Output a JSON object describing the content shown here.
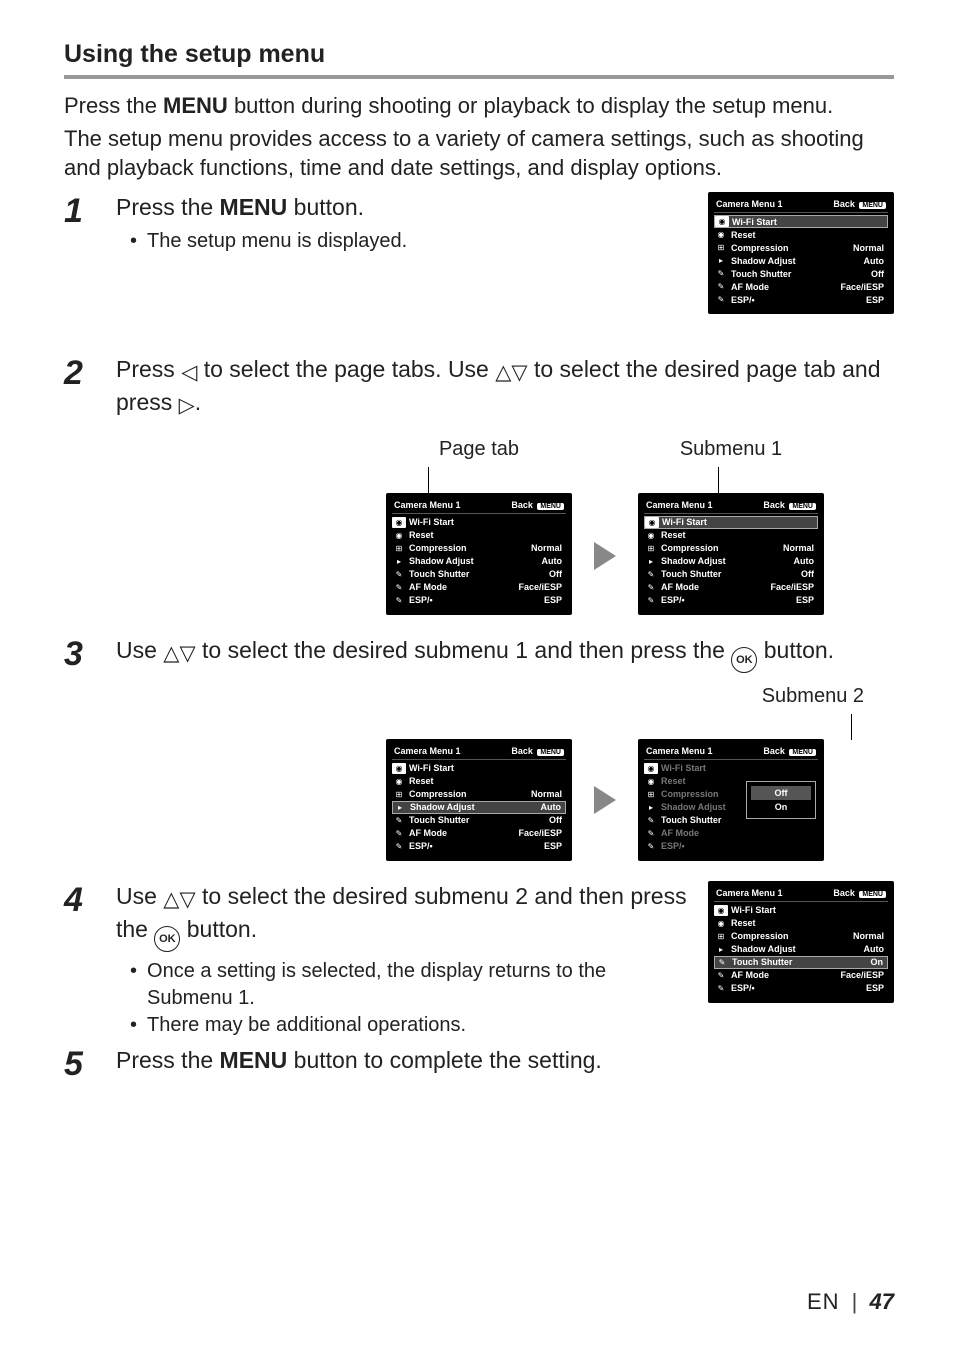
{
  "title": "Using the setup menu",
  "intro1a": "Press the ",
  "intro1b": "MENU",
  "intro1c": " button during shooting or playback to display the setup menu.",
  "intro2": "The setup menu provides access to a variety of camera settings, such as shooting and playback functions, time and date settings, and display options.",
  "ok": "OK",
  "steps": {
    "s1": {
      "num": "1",
      "a": "Press the ",
      "b": "MENU",
      "c": " button.",
      "bullet": "The setup menu is displayed."
    },
    "s2": {
      "num": "2",
      "text_parts": [
        "Press ",
        " to select the page tabs. Use ",
        " to select the desired page tab and press ",
        "."
      ]
    },
    "s3": {
      "num": "3",
      "text_parts": [
        "Use ",
        " to select the desired submenu 1 and then press the ",
        " button."
      ]
    },
    "s4": {
      "num": "4",
      "text_parts": [
        "Use ",
        " to select the desired submenu 2 and then press the ",
        " button."
      ],
      "b1": "Once a setting is selected, the display returns to the Submenu 1.",
      "b2": "There may be additional operations."
    },
    "s5": {
      "num": "5",
      "a": "Press the ",
      "b": "MENU",
      "c": " button to complete the setting."
    }
  },
  "labels": {
    "page_tab": "Page tab",
    "submenu1": "Submenu 1",
    "submenu2": "Submenu 2"
  },
  "cam": {
    "title": "Camera Menu 1",
    "back": "Back",
    "back_badge": "MENU",
    "rows": [
      {
        "icon": "camera-icon",
        "label": "Wi-Fi Start",
        "val": ""
      },
      {
        "icon": "camera-icon",
        "label": "Reset",
        "val": ""
      },
      {
        "icon": "video-icon",
        "label": "Compression",
        "val": "Normal"
      },
      {
        "icon": "play-icon",
        "label": "Shadow Adjust",
        "val": "Auto"
      },
      {
        "icon": "wrench-icon",
        "label": "Touch Shutter",
        "val": "Off"
      },
      {
        "icon": "wrench-icon",
        "label": "AF Mode",
        "val": "Face/iESP"
      },
      {
        "icon": "wrench-icon",
        "label": "ESP/•",
        "val": "ESP"
      }
    ],
    "rows_after": [
      {
        "icon": "camera-icon",
        "label": "Wi-Fi Start",
        "val": ""
      },
      {
        "icon": "camera-icon",
        "label": "Reset",
        "val": ""
      },
      {
        "icon": "video-icon",
        "label": "Compression",
        "val": "Normal"
      },
      {
        "icon": "play-icon",
        "label": "Shadow Adjust",
        "val": "Auto"
      },
      {
        "icon": "wrench-icon",
        "label": "Touch Shutter",
        "val": "On"
      },
      {
        "icon": "wrench-icon",
        "label": "AF Mode",
        "val": "Face/iESP"
      },
      {
        "icon": "wrench-icon",
        "label": "ESP/•",
        "val": "ESP"
      }
    ],
    "popup": {
      "opt1": "Off",
      "opt2": "On"
    }
  },
  "footer": {
    "en": "EN",
    "page": "47"
  }
}
